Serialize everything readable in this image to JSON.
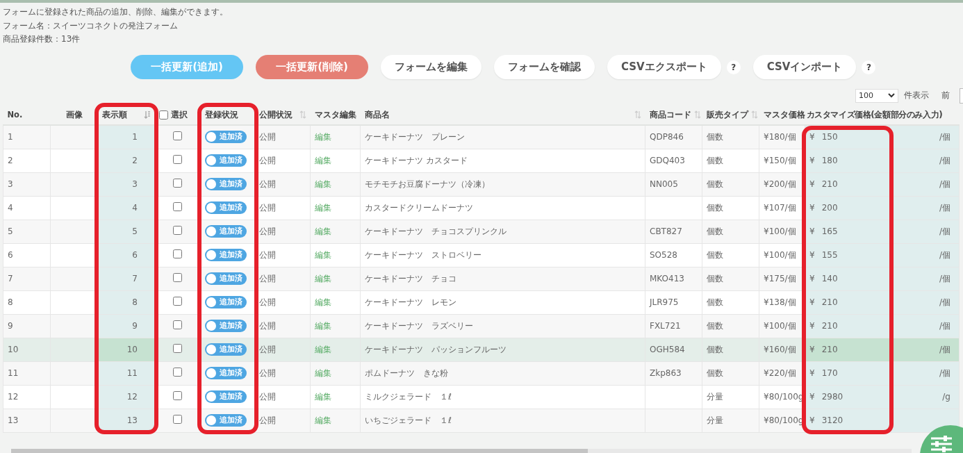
{
  "intro": [
    "フォームに登録された商品の追加、削除、編集ができます。",
    "フォーム名：スイーツコネクトの発注フォーム",
    "商品登録件数：13件"
  ],
  "buttons": [
    {
      "label": "一括更新(追加)",
      "kind": "add"
    },
    {
      "label": "一括更新(削除)",
      "kind": "delete"
    },
    {
      "label": "フォームを編集",
      "kind": "plain"
    },
    {
      "label": "フォームを確認",
      "kind": "plain"
    },
    {
      "label": "CSVエクスポート",
      "kind": "plain",
      "help": "?"
    },
    {
      "label": "CSVインポート",
      "kind": "plain",
      "help": "?"
    }
  ],
  "page_size": {
    "value": "100",
    "label": "件表示"
  },
  "pager": {
    "prev": "前"
  },
  "table": {
    "columns": [
      {
        "label": "No.",
        "highlighted": false
      },
      {
        "label": "画像",
        "highlighted": false
      },
      {
        "label": "表示順",
        "sorted": true,
        "highlighted": true
      },
      {
        "label": "選択",
        "checkbox": false,
        "highlighted": false
      },
      {
        "label": "登録状況",
        "highlighted": true
      },
      {
        "label": "公開状況",
        "sortable": true,
        "highlighted": false
      },
      {
        "label": "マスタ編集",
        "highlighted": false
      },
      {
        "label": "商品名",
        "sortable": true,
        "highlighted": false
      },
      {
        "label": "商品コード",
        "sortable": true,
        "highlighted": false
      },
      {
        "label": "販売タイプ",
        "sortable": true,
        "highlighted": false
      },
      {
        "label": "マスタ価格",
        "highlighted": false
      },
      {
        "label": "カスタマイズ価格(金額部分のみ入力)",
        "highlighted": true
      }
    ],
    "rows": [
      {
        "no": "1",
        "order": "1",
        "checked": false,
        "status": "追加済",
        "on": true,
        "public": "公開",
        "edit": "編集",
        "name": "ケーキドーナツ　プレーン",
        "code": "QDP846",
        "type": "個数",
        "master_price": "¥180/個",
        "currency": "¥",
        "price": "150",
        "unit": "/個",
        "selected": false
      },
      {
        "no": "2",
        "order": "2",
        "checked": false,
        "status": "追加済",
        "on": true,
        "public": "公開",
        "edit": "編集",
        "name": "ケーキドーナツ カスタード",
        "code": "GDQ403",
        "type": "個数",
        "master_price": "¥150/個",
        "currency": "¥",
        "price": "180",
        "unit": "/個",
        "selected": false
      },
      {
        "no": "3",
        "order": "3",
        "checked": false,
        "status": "追加済",
        "on": true,
        "public": "公開",
        "edit": "編集",
        "name": "モチモチお豆腐ドーナツ（冷凍）",
        "code": "NN005",
        "type": "個数",
        "master_price": "¥200/個",
        "currency": "¥",
        "price": "210",
        "unit": "/個",
        "selected": false
      },
      {
        "no": "4",
        "order": "4",
        "checked": false,
        "status": "追加済",
        "on": true,
        "public": "公開",
        "edit": "編集",
        "name": "カスタードクリームドーナツ",
        "type": "個数",
        "master_price": "¥107/個",
        "currency": "¥",
        "price": "200",
        "unit": "/個",
        "selected": false
      },
      {
        "no": "5",
        "order": "5",
        "checked": false,
        "status": "追加済",
        "on": true,
        "public": "公開",
        "edit": "編集",
        "name": "ケーキドーナツ　チョコスプリンクル",
        "code": "CBT827",
        "type": "個数",
        "master_price": "¥100/個",
        "currency": "¥",
        "price": "165",
        "unit": "/個",
        "selected": false
      },
      {
        "no": "6",
        "order": "6",
        "checked": false,
        "status": "追加済",
        "on": true,
        "public": "公開",
        "edit": "編集",
        "name": "ケーキドーナツ　ストロベリー",
        "code": "SO528",
        "type": "個数",
        "master_price": "¥100/個",
        "currency": "¥",
        "price": "155",
        "unit": "/個",
        "selected": false
      },
      {
        "no": "7",
        "order": "7",
        "checked": false,
        "status": "追加済",
        "on": true,
        "public": "公開",
        "edit": "編集",
        "name": "ケーキドーナツ　チョコ",
        "code": "MKO413",
        "type": "個数",
        "master_price": "¥175/個",
        "currency": "¥",
        "price": "140",
        "unit": "/個",
        "selected": false
      },
      {
        "no": "8",
        "order": "8",
        "checked": false,
        "status": "追加済",
        "on": true,
        "public": "公開",
        "edit": "編集",
        "name": "ケーキドーナツ　レモン",
        "code": "JLR975",
        "type": "個数",
        "master_price": "¥138/個",
        "currency": "¥",
        "price": "210",
        "unit": "/個",
        "selected": false
      },
      {
        "no": "9",
        "order": "9",
        "checked": false,
        "status": "追加済",
        "on": true,
        "public": "公開",
        "edit": "編集",
        "name": "ケーキドーナツ　ラズベリー",
        "code": "FXL721",
        "type": "個数",
        "master_price": "¥100/個",
        "currency": "¥",
        "price": "210",
        "unit": "/個",
        "selected": false
      },
      {
        "no": "10",
        "order": "10",
        "checked": false,
        "status": "追加済",
        "on": true,
        "public": "公開",
        "edit": "編集",
        "name": "ケーキドーナツ　パッションフルーツ",
        "code": "OGH584",
        "type": "個数",
        "master_price": "¥160/個",
        "currency": "¥",
        "price": "210",
        "unit": "/個",
        "selected": true
      },
      {
        "no": "11",
        "order": "11",
        "checked": false,
        "status": "追加済",
        "on": true,
        "public": "公開",
        "edit": "編集",
        "name": "ポムドーナツ　きな粉",
        "code": "Zkp863",
        "type": "個数",
        "master_price": "¥220/個",
        "currency": "¥",
        "price": "170",
        "unit": "/個",
        "selected": false
      },
      {
        "no": "12",
        "order": "12",
        "checked": false,
        "status": "追加済",
        "on": true,
        "public": "公開",
        "edit": "編集",
        "name": "ミルクジェラード　１ℓ",
        "type": "分量",
        "master_price": "¥80/100g",
        "currency": "¥",
        "price": "2980",
        "unit": "/g",
        "selected": false
      },
      {
        "no": "13",
        "order": "13",
        "checked": false,
        "status": "追加済",
        "on": true,
        "public": "公開",
        "edit": "編集",
        "name": "いちごジェラード　１ℓ",
        "type": "分量",
        "master_price": "¥80/100g",
        "currency": "¥",
        "price": "3120",
        "selected": false
      }
    ]
  }
}
